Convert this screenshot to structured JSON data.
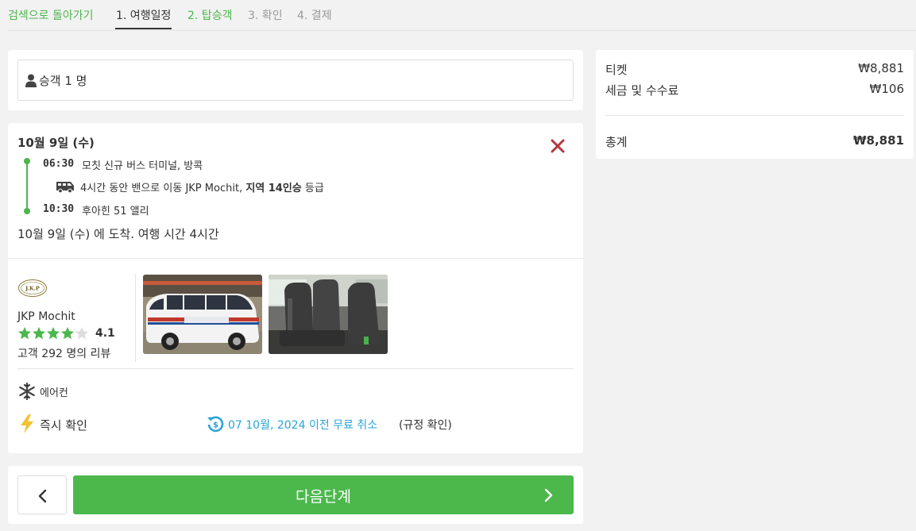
{
  "nav": {
    "back": "검색으로 돌아가기",
    "steps": [
      "1. 여행일정",
      "2. 탑승객",
      "3. 확인",
      "4. 결제"
    ]
  },
  "passenger": {
    "label": "승객 1 명"
  },
  "trip": {
    "date": "10월 9일 (수)",
    "depart_time": "06:30",
    "depart_place": "모칫 신규 버스 터미널, 방콕",
    "travel_prefix": "4시간 동안 밴으로 이동 JKP Mochit, ",
    "travel_class": "지역 14인승",
    "travel_suffix": " 등급",
    "arrive_time": "10:30",
    "arrive_place": "후아힌 51 앨리",
    "arrival_note": "10월 9일 (수) 에 도착. 여행 시간 4시간"
  },
  "operator": {
    "name": "JKP Mochit",
    "rating": "4.1",
    "rating_value": 4.1,
    "reviews": "고객 292 명의 리뷰",
    "logo_text": "J.K.P"
  },
  "features": {
    "aircon": "에어컨",
    "instant": "즉시 확인",
    "cancel": "07 10월, 2024 이전 무료 취소",
    "policy": "(규정 확인)"
  },
  "buttons": {
    "next": "다음단계"
  },
  "summary": {
    "ticket_label": "티켓",
    "ticket_amount": "₩8,881",
    "fee_label": "세금 및 수수료",
    "fee_amount": "₩106",
    "total_label": "총계",
    "total_amount": "₩8,881"
  },
  "colors": {
    "accent_green": "#4cb84c",
    "link_blue": "#2aa5d6",
    "close_red": "#b5373f",
    "star_gray": "#dddddd"
  }
}
